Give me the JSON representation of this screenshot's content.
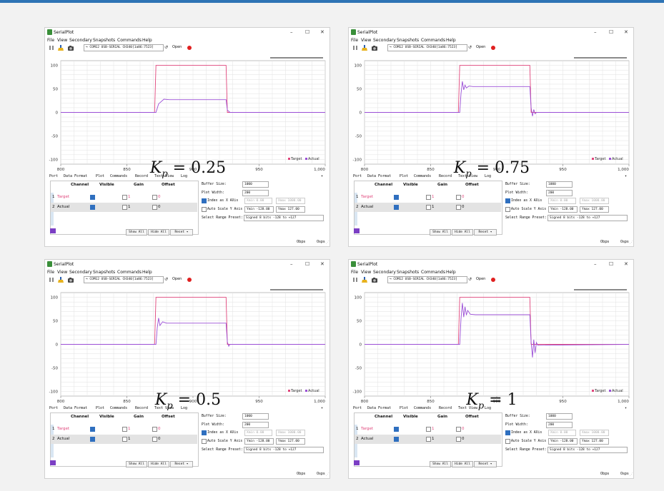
{
  "app": {
    "title": "SerialPlot",
    "menus": [
      "File",
      "View",
      "Secondary",
      "Snapshots",
      "Commands",
      "Help"
    ],
    "window_controls": [
      "–",
      "☐",
      "✕"
    ],
    "port": "↪ COM12 USB-SERIAL CH340[1a86:7523]",
    "reload_glyph": "↺",
    "open_label": "Open",
    "tabs": [
      "Port",
      "Data Format",
      "Plot",
      "Commands",
      "Record",
      "Text View",
      "Log"
    ],
    "table_headers": [
      "Channel",
      "Visible",
      "Gain",
      "Offset"
    ],
    "channels": [
      {
        "num": "1",
        "name": "Target",
        "gain": "1",
        "offset": "0"
      },
      {
        "num": "2",
        "name": "Actual",
        "gain": "1",
        "offset": "0"
      }
    ],
    "buttons": {
      "show_all": "Show All",
      "hide_all": "Hide All",
      "reset": "Reset"
    },
    "settings": {
      "buffer_label": "Buffer Size:",
      "buffer_value": "1000",
      "width_label": "Plot Width:",
      "width_value": "200",
      "index_label": "Index as X AXis",
      "xmin": "Xmin 0.00",
      "xmax": "Xmax 1000.00",
      "autoscale_label": "Auto Scale Y Axis",
      "ymin": "Ymin -128.00",
      "ymax": "Ymax 127.00",
      "preset_label": "Select Range Preset:",
      "preset_value": "Signed 8 bits -128 to +127"
    },
    "status": {
      "bps": "0bps",
      "sps": "0sps"
    },
    "legend": {
      "target": "Target",
      "actual": "Actual"
    },
    "colors": {
      "target": "#e0457b",
      "actual": "#9b4fd6",
      "grid": "#e2e2e2",
      "record": "#e02020"
    }
  },
  "kp_var": "K",
  "kp_sub": "p",
  "panels": [
    {
      "kp_value": "0.25"
    },
    {
      "kp_value": "0.75"
    },
    {
      "kp_value": "0.5"
    },
    {
      "kp_value": "1"
    }
  ],
  "chart_data": [
    {
      "type": "line",
      "xlim": [
        800,
        1000
      ],
      "ylim": [
        -110,
        110
      ],
      "xticks": [
        "800",
        "850",
        "900",
        "950",
        "1,000"
      ],
      "yticks": [
        "100",
        "50",
        "0",
        "-50",
        "-100"
      ],
      "series": [
        {
          "name": "Target",
          "x": [
            800,
            871,
            872,
            925,
            926,
            1000
          ],
          "y": [
            0,
            0,
            100,
            100,
            0,
            0
          ]
        },
        {
          "name": "Actual",
          "x": [
            800,
            872,
            874,
            878,
            882,
            900,
            925,
            926,
            928,
            1000
          ],
          "y": [
            0,
            0,
            18,
            28,
            27,
            27,
            27,
            5,
            0,
            0
          ]
        }
      ]
    },
    {
      "type": "line",
      "xlim": [
        800,
        1000
      ],
      "ylim": [
        -110,
        110
      ],
      "xticks": [
        "800",
        "850",
        "900",
        "950",
        "1,000"
      ],
      "yticks": [
        "100",
        "50",
        "0",
        "-50",
        "-100"
      ],
      "series": [
        {
          "name": "Target",
          "x": [
            800,
            871,
            872,
            925,
            926,
            1000
          ],
          "y": [
            0,
            0,
            100,
            100,
            0,
            0
          ]
        },
        {
          "name": "Actual",
          "x": [
            800,
            872,
            873,
            874,
            875,
            876,
            877,
            879,
            882,
            900,
            925,
            926,
            927,
            928,
            929,
            930,
            1000
          ],
          "y": [
            0,
            0,
            40,
            66,
            48,
            58,
            52,
            56,
            55,
            55,
            55,
            10,
            -8,
            6,
            -3,
            0,
            0
          ]
        }
      ]
    },
    {
      "type": "line",
      "xlim": [
        800,
        1000
      ],
      "ylim": [
        -110,
        110
      ],
      "xticks": [
        "800",
        "850",
        "900",
        "950",
        "1,000"
      ],
      "yticks": [
        "100",
        "50",
        "0",
        "-50",
        "-100"
      ],
      "series": [
        {
          "name": "Target",
          "x": [
            800,
            871,
            872,
            925,
            926,
            1000
          ],
          "y": [
            0,
            0,
            100,
            100,
            0,
            0
          ]
        },
        {
          "name": "Actual",
          "x": [
            800,
            872,
            873,
            874,
            875,
            877,
            880,
            900,
            925,
            926,
            927,
            928,
            1000
          ],
          "y": [
            0,
            0,
            35,
            56,
            40,
            48,
            45,
            45,
            45,
            5,
            -4,
            0,
            0
          ]
        }
      ]
    },
    {
      "type": "line",
      "xlim": [
        800,
        1000
      ],
      "ylim": [
        -110,
        110
      ],
      "xticks": [
        "800",
        "850",
        "900",
        "950",
        "1,000"
      ],
      "yticks": [
        "100",
        "50",
        "0",
        "-50",
        "-100"
      ],
      "series": [
        {
          "name": "Target",
          "x": [
            800,
            871,
            872,
            925,
            926,
            1000
          ],
          "y": [
            0,
            0,
            100,
            100,
            0,
            0
          ]
        },
        {
          "name": "Actual",
          "x": [
            800,
            872,
            873,
            874,
            875,
            876,
            877,
            878,
            880,
            884,
            900,
            925,
            926,
            927,
            928,
            929,
            930,
            931,
            1000
          ],
          "y": [
            0,
            0,
            55,
            88,
            58,
            80,
            62,
            72,
            64,
            63,
            63,
            63,
            5,
            -28,
            10,
            -18,
            4,
            -2,
            0
          ]
        }
      ]
    }
  ]
}
